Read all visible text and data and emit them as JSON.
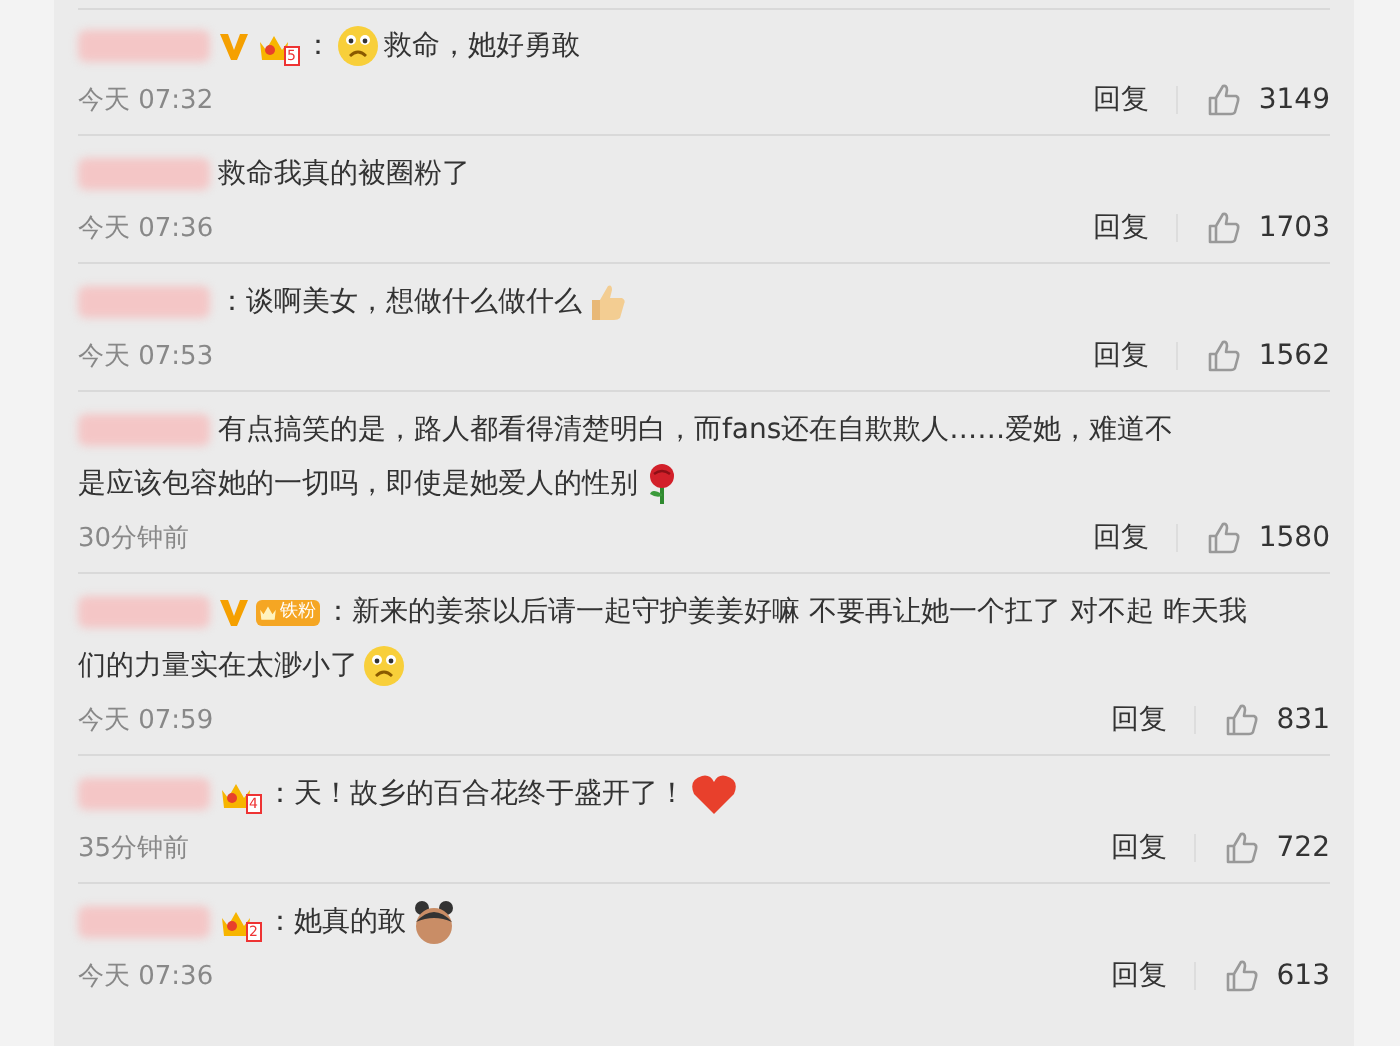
{
  "comments": [
    {
      "badges": [
        {
          "kind": "verified"
        },
        {
          "kind": "crown",
          "label": "5"
        }
      ],
      "content": [
        {
          "kind": "text",
          "text": "："
        },
        {
          "kind": "sad"
        },
        {
          "kind": "text",
          "text": "救命，她好勇敢"
        }
      ],
      "time": "今天 07:32",
      "reply": "回复",
      "likes": "3149"
    },
    {
      "content": [
        {
          "kind": "text",
          "text": "救命我真的被圈粉了"
        }
      ],
      "time": "今天 07:36",
      "reply": "回复",
      "likes": "1703"
    },
    {
      "content": [
        {
          "kind": "text",
          "text": "：谈啊美女，想做什么做什么"
        },
        {
          "kind": "thumb"
        }
      ],
      "time": "今天 07:53",
      "reply": "回复",
      "likes": "1562"
    },
    {
      "content": [
        {
          "kind": "text",
          "text": "有点搞笑的是，路人都看得清楚明白，而fans还在自欺欺人……爱她，难道不"
        },
        {
          "kind": "br"
        },
        {
          "kind": "text",
          "text": "是应该包容她的一切吗，即使是她爱人的性别"
        },
        {
          "kind": "rose"
        }
      ],
      "time": "30分钟前",
      "reply": "回复",
      "likes": "1580"
    },
    {
      "badges": [
        {
          "kind": "verified"
        },
        {
          "kind": "fan",
          "label": "铁粉"
        }
      ],
      "content": [
        {
          "kind": "text",
          "text": "：新来的姜茶以后请一起守护姜姜好嘛 不要再让她一个扛了  对不起 昨天我"
        },
        {
          "kind": "br"
        },
        {
          "kind": "text",
          "text": "们的力量实在太渺小了"
        },
        {
          "kind": "sad"
        }
      ],
      "time": "今天 07:59",
      "reply": "回复",
      "likes": "831"
    },
    {
      "badges": [
        {
          "kind": "crown",
          "label": "4"
        }
      ],
      "content": [
        {
          "kind": "text",
          "text": "：天！故乡的百合花终于盛开了！"
        },
        {
          "kind": "heart"
        }
      ],
      "time": "35分钟前",
      "reply": "回复",
      "likes": "722"
    },
    {
      "badges": [
        {
          "kind": "crown",
          "label": "2"
        }
      ],
      "content": [
        {
          "kind": "text",
          "text": "：她真的敢"
        },
        {
          "kind": "head"
        }
      ],
      "time": "今天 07:36",
      "reply": "回复",
      "likes": "613"
    }
  ]
}
